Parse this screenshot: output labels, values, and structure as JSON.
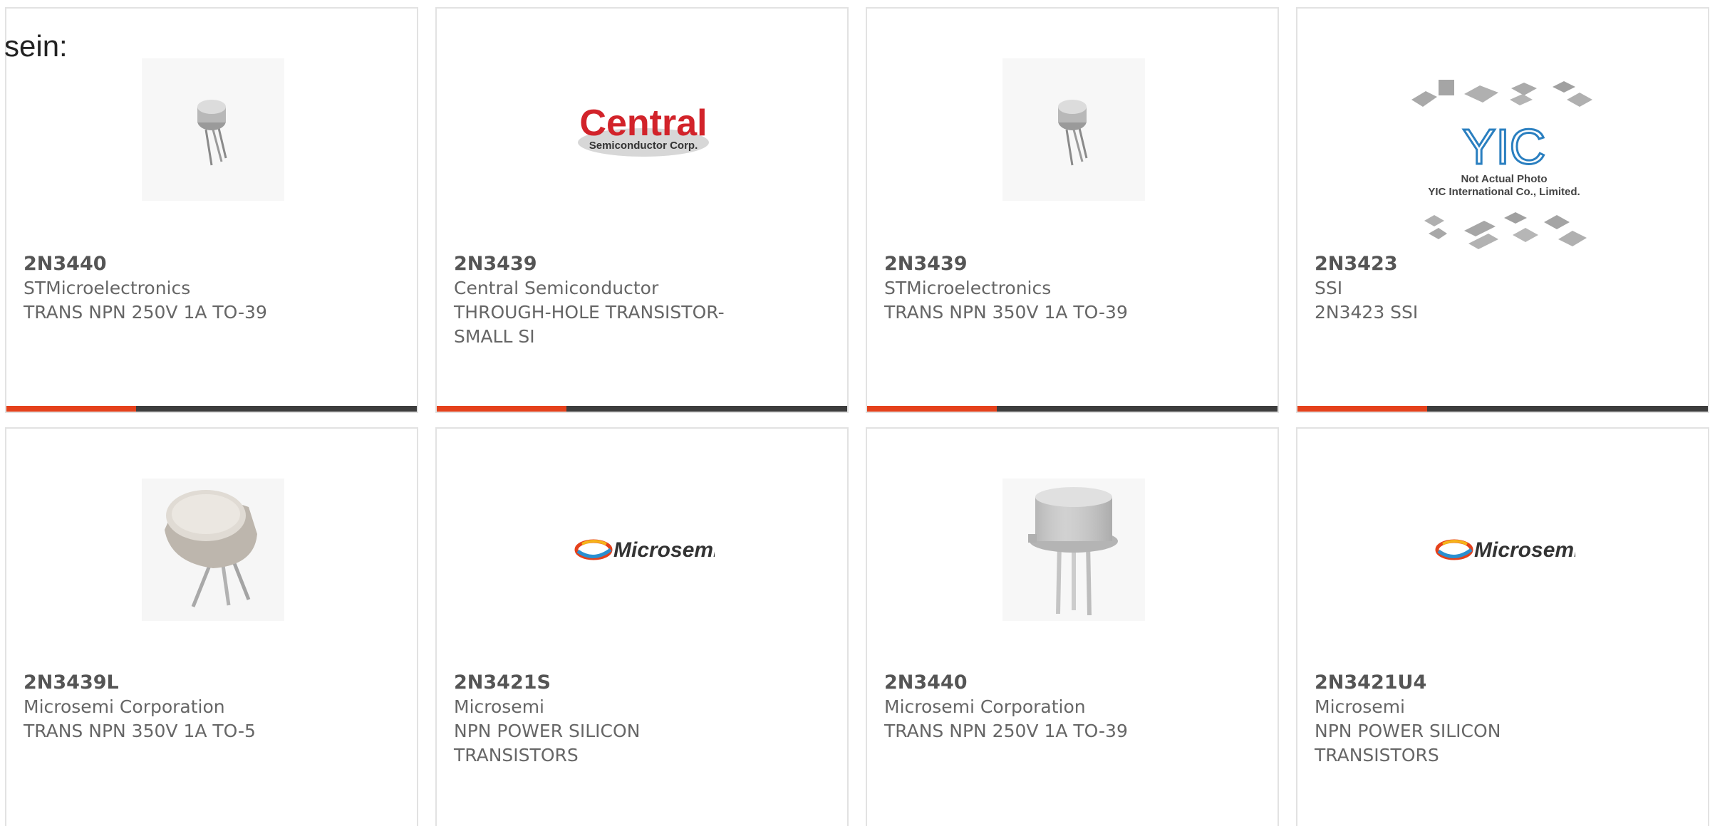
{
  "intro_text": "sein:",
  "colors": {
    "accent": "#e5411b",
    "bar": "#3d3d3d",
    "border": "#e2e2e2",
    "text": "#666666"
  },
  "products": [
    {
      "part": "2N3440",
      "manufacturer": "STMicroelectronics",
      "description": "TRANS NPN 250V 1A TO-39",
      "image": "to39-small-transistor"
    },
    {
      "part": "2N3439",
      "manufacturer": "Central Semiconductor",
      "description": "THROUGH-HOLE TRANSISTOR-SMALL SI",
      "image": "central-logo",
      "logo_main": "Central",
      "logo_sub": "Semiconductor Corp."
    },
    {
      "part": "2N3439",
      "manufacturer": "STMicroelectronics",
      "description": "TRANS NPN 350V 1A TO-39",
      "image": "to39-small-transistor"
    },
    {
      "part": "2N3423",
      "manufacturer": "SSI",
      "description": "2N3423 SSI",
      "image": "yic-placeholder",
      "logo_main": "YIC",
      "caption_line1": "Not Actual Photo",
      "caption_line2": "YIC International Co., Limited."
    },
    {
      "part": "2N3439L",
      "manufacturer": "Microsemi Corporation",
      "description": "TRANS NPN 350V 1A TO-5",
      "image": "to5-transistor"
    },
    {
      "part": "2N3421S",
      "manufacturer": "Microsemi",
      "description": "NPN POWER SILICON TRANSISTORS",
      "image": "microsemi-logo",
      "logo_main": "Microsemi"
    },
    {
      "part": "2N3440",
      "manufacturer": "Microsemi Corporation",
      "description": "TRANS NPN 250V 1A TO-39",
      "image": "to39-large-transistor"
    },
    {
      "part": "2N3421U4",
      "manufacturer": "Microsemi",
      "description": "NPN POWER SILICON TRANSISTORS",
      "image": "microsemi-logo",
      "logo_main": "Microsemi"
    }
  ]
}
